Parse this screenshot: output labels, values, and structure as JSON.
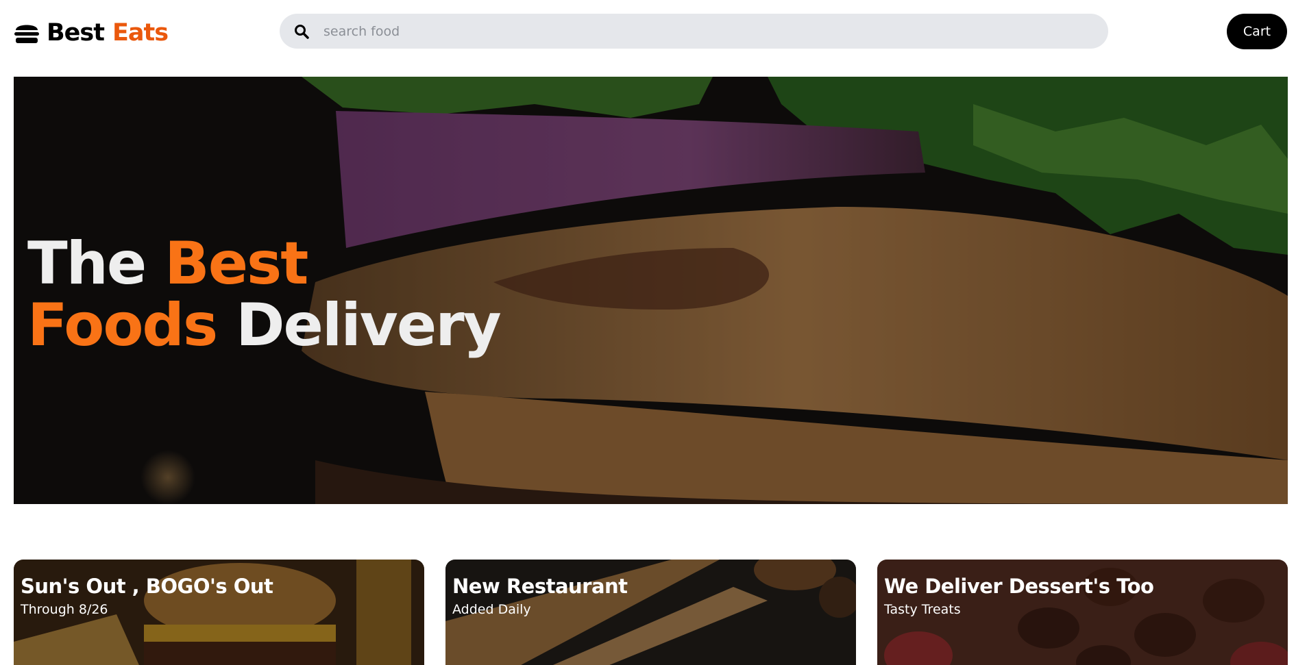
{
  "brand": {
    "name_first": "Best",
    "name_second": "Eats",
    "logo_icon": "hamburger-icon",
    "accent_color": "#ea580c"
  },
  "search": {
    "icon": "search-icon",
    "placeholder": "search food",
    "value": ""
  },
  "cart": {
    "label": "Cart"
  },
  "hero": {
    "headline_part1": "The",
    "headline_part2": "Best",
    "headline_part3": "Foods",
    "headline_part4": "Delivery",
    "highlight_color": "#f97316"
  },
  "cards": [
    {
      "title": "Sun's Out , BOGO's Out",
      "subtitle": "Through 8/26"
    },
    {
      "title": "New Restaurant",
      "subtitle": "Added Daily"
    },
    {
      "title": "We Deliver Dessert's Too",
      "subtitle": "Tasty Treats"
    }
  ]
}
